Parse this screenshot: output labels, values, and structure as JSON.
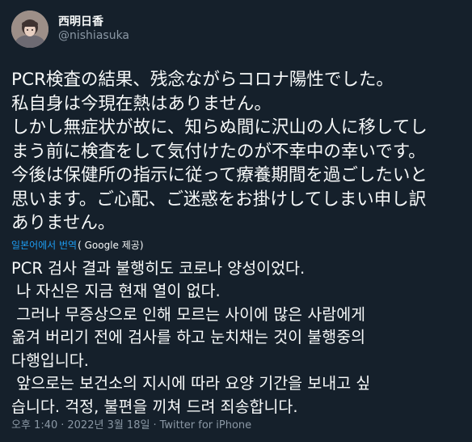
{
  "author": {
    "display_name": "西明日香",
    "handle": "@nishiasuka"
  },
  "tweet": {
    "original_text": "PCR検査の結果、残念ながらコロナ陽性でした。\n私自身は今現在熱はありません。\nしかし無症状が故に、知らぬ間に沢山の人に移してし\nまう前に検査をして気付けたのが不幸中の幸いです。\n今後は保健所の指示に従って療養期間を過ごしたいと\n思います。ご心配、ご迷惑をお掛けしてしまい申し訳\nありません。",
    "translate_link": "일본어에서 번역",
    "translate_provider": "( Google 제공)",
    "translated_text": "PCR 검사 결과 불행히도 코로나 양성이었다.\n 나 자신은 지금 현재 열이 없다.\n 그러나 무증상으로 인해 모르는 사이에 많은 사람에게\n옮겨 버리기 전에 검사를 하고 눈치채는 것이 불행중의\n다행입니다.\n 앞으로는 보건소의 지시에 따라 요양 기간을 보내고 싶\n습니다. 걱정, 불편을 끼쳐 드려 죄송합니다.",
    "time": "오후 1:40",
    "separator": "·",
    "date": "2022년 3월 18일",
    "source": "Twitter for iPhone"
  },
  "colors": {
    "background": "#15202b",
    "text_primary": "#f7f9f9",
    "text_secondary": "#8b98a5",
    "link": "#1d9bf0"
  }
}
